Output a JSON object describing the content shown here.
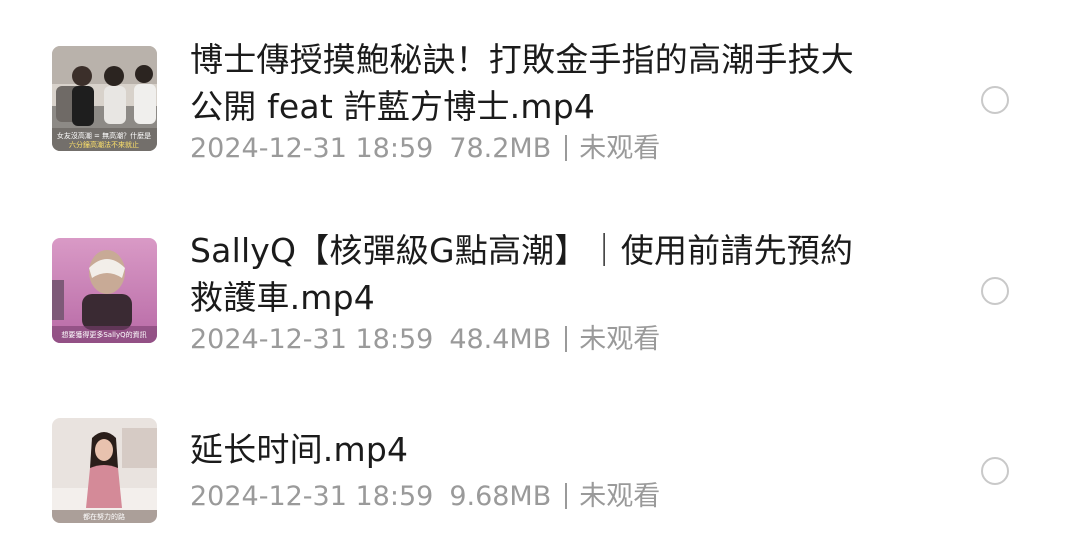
{
  "files": [
    {
      "title_line1": "博士傳授摸鮑秘訣！打敗金手指的高潮手技大",
      "title_line2": "公開 feat 許藍方博士.mp4",
      "datetime": "2024-12-31 18:59",
      "size": "78.2MB",
      "status": "未观看",
      "thumbnail_caption": "女友沒高潮 = 無高潮？什麼是",
      "thumbnail_caption2": "六分鐘高潮法不來就止"
    },
    {
      "title_line1": "SallyQ【核彈級G點高潮】｜使用前請先預約",
      "title_line2": "救護車.mp4",
      "datetime": "2024-12-31 18:59",
      "size": "48.4MB",
      "status": "未观看",
      "thumbnail_caption": "想要獲得更多SallyQ的資訊"
    },
    {
      "title_line1": "延长时间.mp4",
      "datetime": "2024-12-31 18:59",
      "size": "9.68MB",
      "status": "未观看",
      "thumbnail_caption": "都在努力的路"
    }
  ],
  "colors": {
    "title": "#1b1b1b",
    "meta": "#9a9a9a",
    "radio_border": "#c9c9c9"
  },
  "icons": {
    "select": "radio-circle-icon"
  }
}
